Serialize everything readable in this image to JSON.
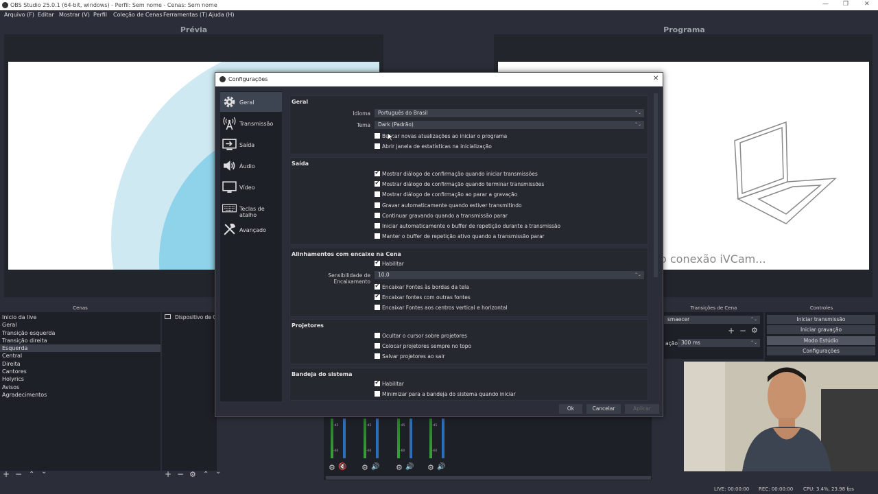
{
  "window": {
    "title": "OBS Studio 25.0.1 (64-bit, windows) - Perfil: Sem nome - Cenas: Sem nome",
    "min": "—",
    "max": "❐",
    "close": "✕"
  },
  "menu": [
    "Arquivo (F)",
    "Editar",
    "Mostrar (V)",
    "Perfil",
    "Coleção de Cenas",
    "Ferramentas (T)",
    "Ajuda (H)"
  ],
  "preview": {
    "label": "Prévia"
  },
  "program": {
    "label": "Programa",
    "overlay_text": "o conexão iVCam..."
  },
  "scenes": {
    "title": "Cenas",
    "items": [
      "Inicio da live",
      "Geral",
      "Transição esquerda",
      "Transição direita",
      "Esquerda",
      "Central",
      "Direita",
      "Cantores",
      "Holyrics",
      "Avisos",
      "Agradecimentos"
    ],
    "selected_index": 4
  },
  "sources": {
    "items": [
      "Dispositivo de Cap"
    ]
  },
  "transitions": {
    "title": "Transições de Cena",
    "type": "smaecer",
    "duration_label": "ação",
    "duration": "300 ms"
  },
  "controls": {
    "title": "Controles",
    "buttons": [
      "Iniciar transmissão",
      "Iniciar gravação",
      "Modo Estúdio",
      "Configurações"
    ]
  },
  "status": {
    "live": "LIVE: 00:00:00",
    "rec": "REC: 00:00:00",
    "cpu": "CPU: 3.4%, 23.98 fps"
  },
  "mixer": {
    "scale": [
      "-45",
      "-50",
      "-55",
      "-60"
    ]
  },
  "dialog": {
    "title": "Configurações",
    "close": "✕",
    "nav": [
      {
        "label": "Geral",
        "icon": "gear-icon"
      },
      {
        "label": "Transmissão",
        "icon": "antenna-icon"
      },
      {
        "label": "Saída",
        "icon": "output-icon"
      },
      {
        "label": "Áudio",
        "icon": "speaker-icon"
      },
      {
        "label": "Vídeo",
        "icon": "monitor-icon"
      },
      {
        "label": "Teclas de atalho",
        "icon": "keyboard-icon"
      },
      {
        "label": "Avançado",
        "icon": "tools-icon"
      }
    ],
    "selected_nav": 0,
    "geral": {
      "title": "Geral",
      "idioma_label": "Idioma",
      "idioma_value": "Português do Brasil",
      "tema_label": "Tema",
      "tema_value": "Dark (Padrão)",
      "checks": [
        {
          "label": "Buscar novas atualizações ao iniciar o programa",
          "checked": false
        },
        {
          "label": "Abrir janela de estatísticas na inicialização",
          "checked": false
        }
      ]
    },
    "saida": {
      "title": "Saída",
      "checks": [
        {
          "label": "Mostrar diálogo de confirmação quando iniciar transmissões",
          "checked": true
        },
        {
          "label": "Mostrar diálogo de confirmação quando terminar transmissões",
          "checked": true
        },
        {
          "label": "Mostrar diálogo de confirmação ao parar a gravação",
          "checked": false
        },
        {
          "label": "Gravar automaticamente quando estiver transmitindo",
          "checked": false
        },
        {
          "label": "Continuar gravando quando a transmissão parar",
          "checked": false
        },
        {
          "label": "Iniciar automaticamente o buffer de repetição durante a transmissão",
          "checked": false
        },
        {
          "label": "Manter o buffer de repetição ativo quando a transmissão parar",
          "checked": false
        }
      ]
    },
    "snap": {
      "title": "Alinhamentos com encaixe na Cena",
      "habilitar": {
        "label": "Habilitar",
        "checked": true
      },
      "sens_label": "Sensibilidade de Encaixamento",
      "sens_value": "10,0",
      "checks": [
        {
          "label": "Encaixar Fontes às bordas da tela",
          "checked": true
        },
        {
          "label": "Encaixar fontes com outras fontes",
          "checked": true
        },
        {
          "label": "Encaixar Fontes aos centros vertical e horizontal",
          "checked": false
        }
      ]
    },
    "proj": {
      "title": "Projetores",
      "checks": [
        {
          "label": "Ocultar o cursor sobre projetores",
          "checked": false
        },
        {
          "label": "Colocar projetores sempre no topo",
          "checked": false
        },
        {
          "label": "Salvar projetores ao sair",
          "checked": false
        }
      ]
    },
    "tray": {
      "title": "Bandeja do sistema",
      "checks": [
        {
          "label": "Habilitar",
          "checked": true
        },
        {
          "label": "Minimizar para a bandeja do sistema quando iniciar",
          "checked": false
        }
      ]
    },
    "buttons": {
      "ok": "Ok",
      "cancel": "Cancelar",
      "apply": "Aplicar"
    }
  }
}
